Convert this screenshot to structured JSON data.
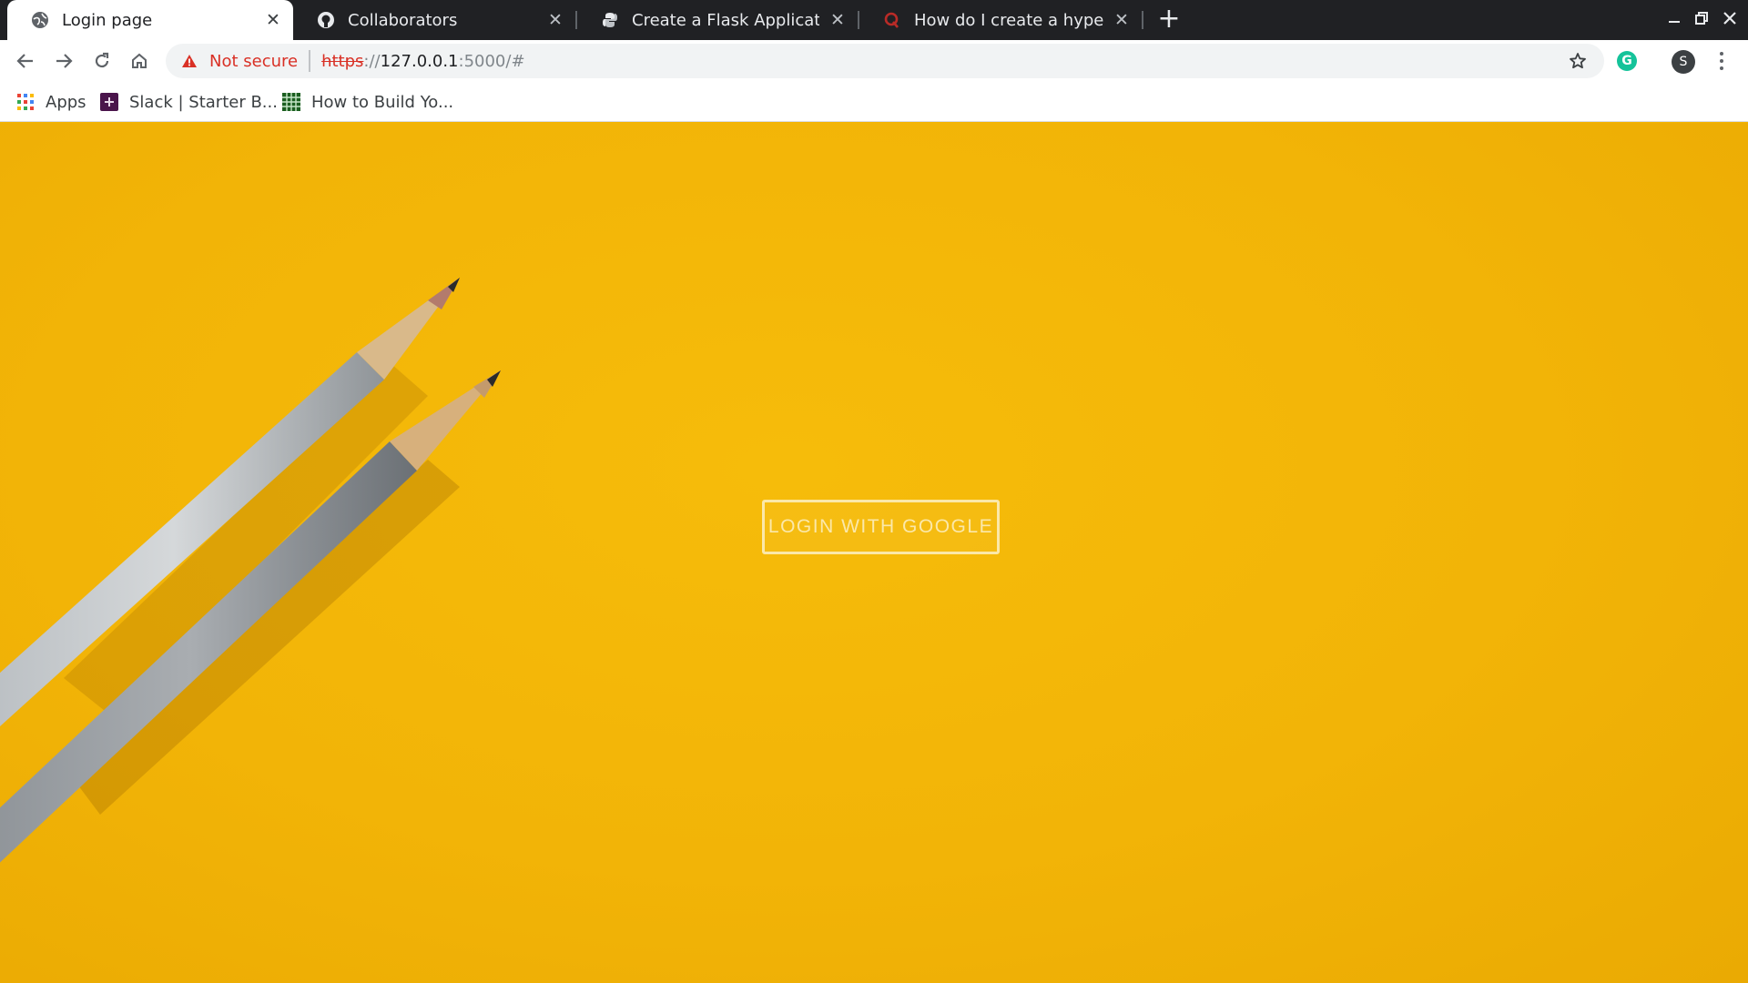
{
  "browser": {
    "tabs": [
      {
        "title": "Login page",
        "icon": "globe-icon",
        "active": true
      },
      {
        "title": "Collaborators",
        "icon": "github-icon",
        "active": false
      },
      {
        "title": "Create a Flask Application Wi",
        "icon": "python-icon",
        "active": false
      },
      {
        "title": "How do I create a hyperlink i",
        "icon": "quora-icon",
        "active": false
      }
    ],
    "new_tab_icon": "plus-icon"
  },
  "toolbar": {
    "security_label": "Not secure",
    "url": {
      "scheme": "https",
      "separator": "://",
      "host": "127.0.0.1",
      "rest": ":5000/#"
    },
    "extension_letter": "G",
    "profile_letter": "S"
  },
  "bookmarks": [
    {
      "label": "Apps",
      "icon": "apps-grid-icon"
    },
    {
      "label": "Slack | Starter B...",
      "icon": "slack-icon"
    },
    {
      "label": "How to Build Yo...",
      "icon": "grid-logo-icon"
    }
  ],
  "page": {
    "login_button_label": "LOGIN WITH GOOGLE"
  },
  "colors": {
    "page_background": "#f4b400",
    "button_border": "#fbe8a9",
    "warning": "#d93025",
    "tabstrip": "#202124"
  }
}
